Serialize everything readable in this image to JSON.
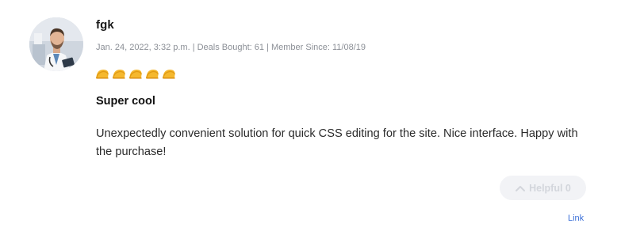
{
  "review": {
    "reviewer": {
      "name": "fgk",
      "avatar": "doctor-portrait"
    },
    "meta": "Jan. 24, 2022, 3:32 p.m. | Deals Bought: 61 | Member Since: 11/08/19",
    "rating": {
      "value": 5,
      "max": 5,
      "icon": "taco-icon",
      "color": "#f5b82e"
    },
    "title": "Super cool",
    "body": "Unexpectedly convenient solution for quick CSS editing for the site. Nice interface. Happy with the purchase!",
    "helpful": {
      "label": "Helpful 0",
      "icon": "chevron-up-icon"
    },
    "link_label": "Link",
    "colors": {
      "accent_link": "#3a6fd8",
      "meta_text": "#8b8f96",
      "helpful_bg": "#f2f3f6"
    }
  }
}
